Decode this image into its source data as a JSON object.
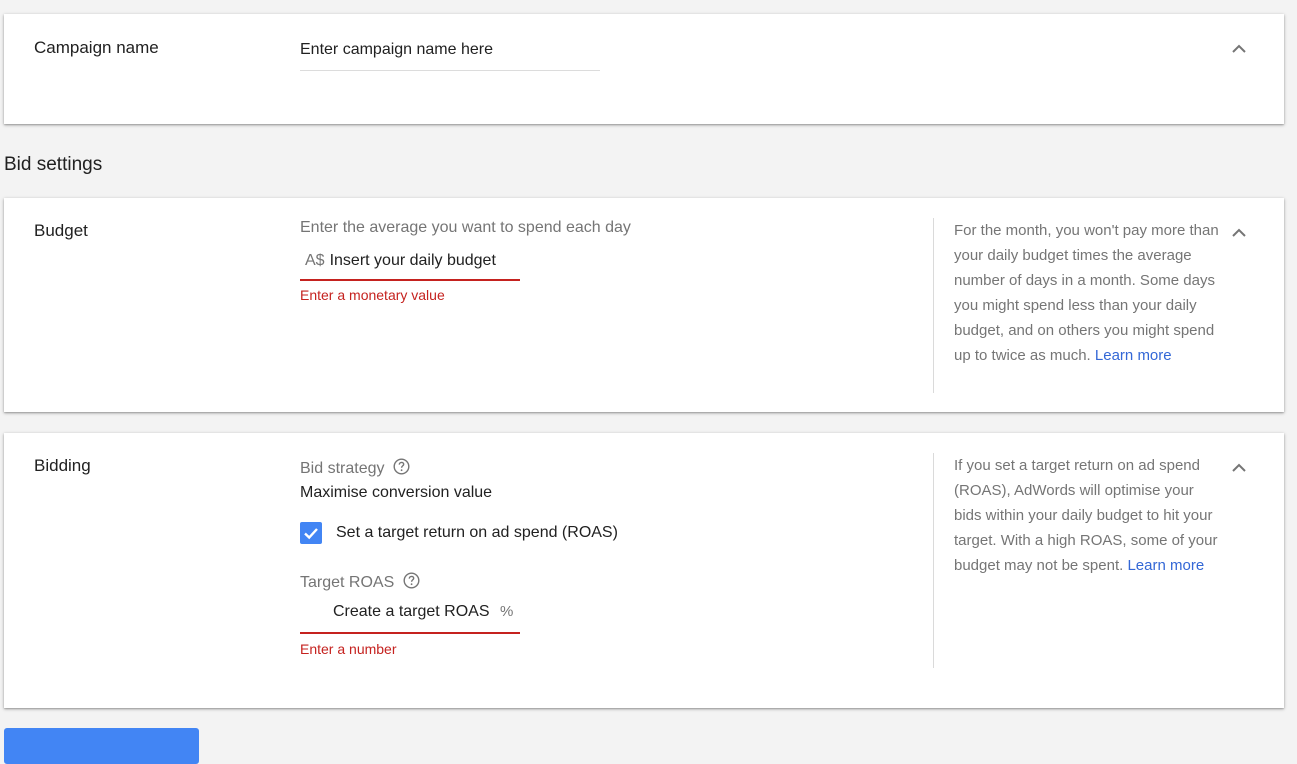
{
  "campaign_name": {
    "title": "Campaign name",
    "input_value": "Enter campaign name here",
    "collapse_icon": "chevron-up-icon"
  },
  "bid_settings": {
    "heading": "Bid settings"
  },
  "budget": {
    "title": "Budget",
    "helper_label": "Enter the average you want to spend each day",
    "currency_prefix": "A$",
    "input_value": "Insert your daily budget",
    "error": "Enter a monetary value",
    "info_text": "For the month, you won't pay more than your daily budget times the average number of days in a month. Some days you might spend less than your daily budget, and on others you might spend up to twice as much.",
    "learn_more": "Learn more",
    "collapse_icon": "chevron-up-icon"
  },
  "bidding": {
    "title": "Bidding",
    "strategy_label": "Bid strategy",
    "strategy_value": "Maximise conversion value",
    "checkbox_label": "Set a target return on ad spend (ROAS)",
    "checkbox_checked": true,
    "target_label": "Target ROAS",
    "input_value": "Create a target ROAS",
    "suffix": "%",
    "error": "Enter a number",
    "info_text": "If you set a target return on ad spend (ROAS), AdWords will optimise your bids within your daily budget to hit your target. With a high ROAS, some of your budget may not be spent.",
    "learn_more": "Learn more",
    "collapse_icon": "chevron-up-icon",
    "help_icon": "help-circle-icon"
  },
  "colors": {
    "accent_blue": "#4285f4",
    "error_red": "#c5221f",
    "link_blue": "#3367d6"
  }
}
